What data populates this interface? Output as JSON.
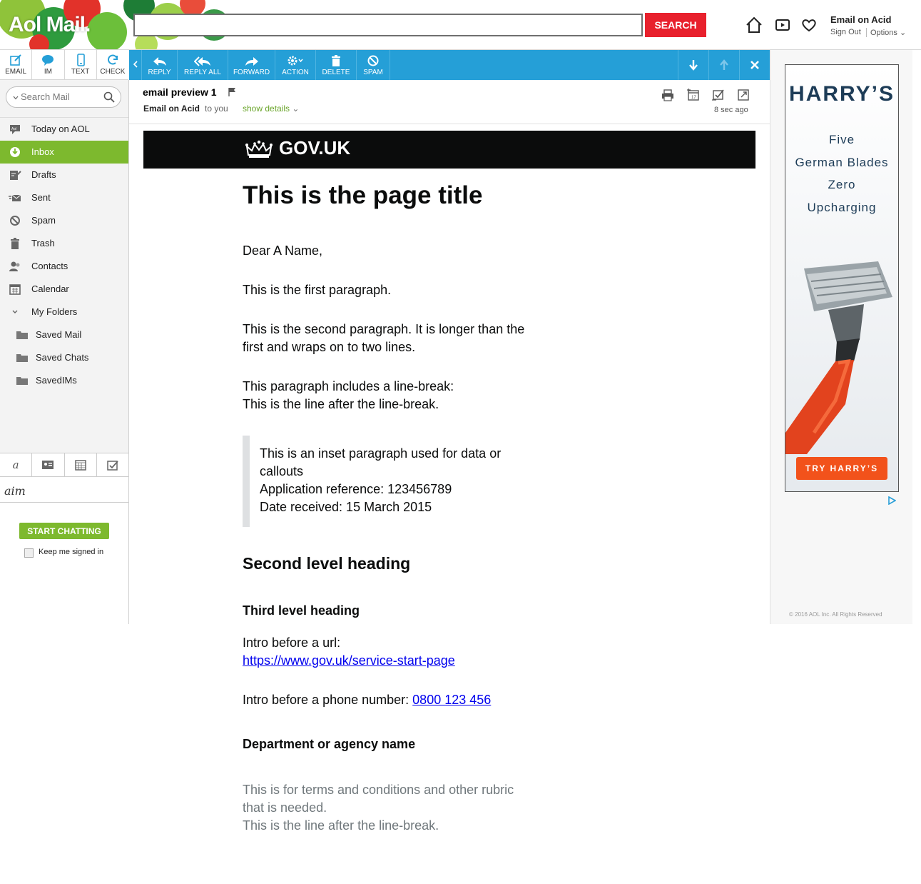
{
  "header": {
    "logo": "Aol Mail.",
    "search_placeholder": "",
    "search_button": "SEARCH",
    "account_name": "Email on Acid",
    "sign_out": "Sign Out",
    "options": "Options"
  },
  "compose_bar": [
    {
      "label": "EMAIL",
      "icon": "compose-icon"
    },
    {
      "label": "IM",
      "icon": "chat-bubble-icon"
    },
    {
      "label": "TEXT",
      "icon": "phone-icon"
    },
    {
      "label": "CHECK",
      "icon": "refresh-icon"
    }
  ],
  "toolbar": {
    "reply": "REPLY",
    "reply_all": "REPLY ALL",
    "forward": "FORWARD",
    "action": "ACTION",
    "delete": "DELETE",
    "spam": "SPAM"
  },
  "sidebar": {
    "search_placeholder": "Search Mail",
    "folders": [
      {
        "label": "Today on AOL",
        "icon": "aol-icon"
      },
      {
        "label": "Inbox",
        "icon": "inbox-icon",
        "active": true
      },
      {
        "label": "Drafts",
        "icon": "drafts-icon"
      },
      {
        "label": "Sent",
        "icon": "sent-icon"
      },
      {
        "label": "Spam",
        "icon": "spam-icon"
      },
      {
        "label": "Trash",
        "icon": "trash-icon"
      },
      {
        "label": "Contacts",
        "icon": "contacts-icon"
      },
      {
        "label": "Calendar",
        "icon": "calendar-icon"
      },
      {
        "label": "My Folders",
        "icon": "chevron-down-icon"
      },
      {
        "label": "Saved Mail",
        "icon": "folder-icon"
      },
      {
        "label": "Saved Chats",
        "icon": "folder-icon"
      },
      {
        "label": "SavedIMs",
        "icon": "folder-icon"
      }
    ],
    "aim_logo": "aim",
    "start_chatting": "START CHATTING",
    "keep_signed_in": "Keep me signed in"
  },
  "message": {
    "subject": "email preview 1",
    "from": "Email on Acid",
    "to": "to you",
    "show_details": "show details",
    "time": "8 sec ago"
  },
  "email": {
    "gov_logo": "GOV.UK",
    "page_title": "This is the page title",
    "greeting": "Dear A Name,",
    "para1": "This is the first paragraph.",
    "para2_line1": "This is the second paragraph. It is longer than the",
    "para2_line2": "first and wraps on to two lines.",
    "para3_line1": "This paragraph includes a line-break:",
    "para3_line2": "This is the line after the line-break.",
    "inset_line1": "This is an inset paragraph used for data or",
    "inset_line2": "callouts",
    "inset_line3": "Application reference: 123456789",
    "inset_line4": "Date received: 15 March 2015",
    "h2": "Second level heading",
    "h3": "Third level heading",
    "url_intro": "Intro before a url:",
    "url": "https://www.gov.uk/service-start-page",
    "phone_intro": "Intro before a phone number: ",
    "phone": "0800 123 456",
    "department": "Department or agency name",
    "rubric_line1": "This is for terms and conditions and other rubric",
    "rubric_line2": "that is needed.",
    "rubric_line3": "This is the line after the line-break."
  },
  "ad": {
    "brand": "HARRY’S",
    "line1": "Five",
    "line2": "German Blades",
    "line3": "Zero",
    "line4": "Upcharging",
    "cta": "TRY HARRY’S",
    "copyright": "© 2016 AOL Inc. All Rights Reserved"
  },
  "colors": {
    "toolbar": "#259fd7",
    "active_folder": "#7db92e",
    "search_button": "#e8212d",
    "gov_header": "#0b0c0c",
    "ad_cta": "#f2521b"
  }
}
